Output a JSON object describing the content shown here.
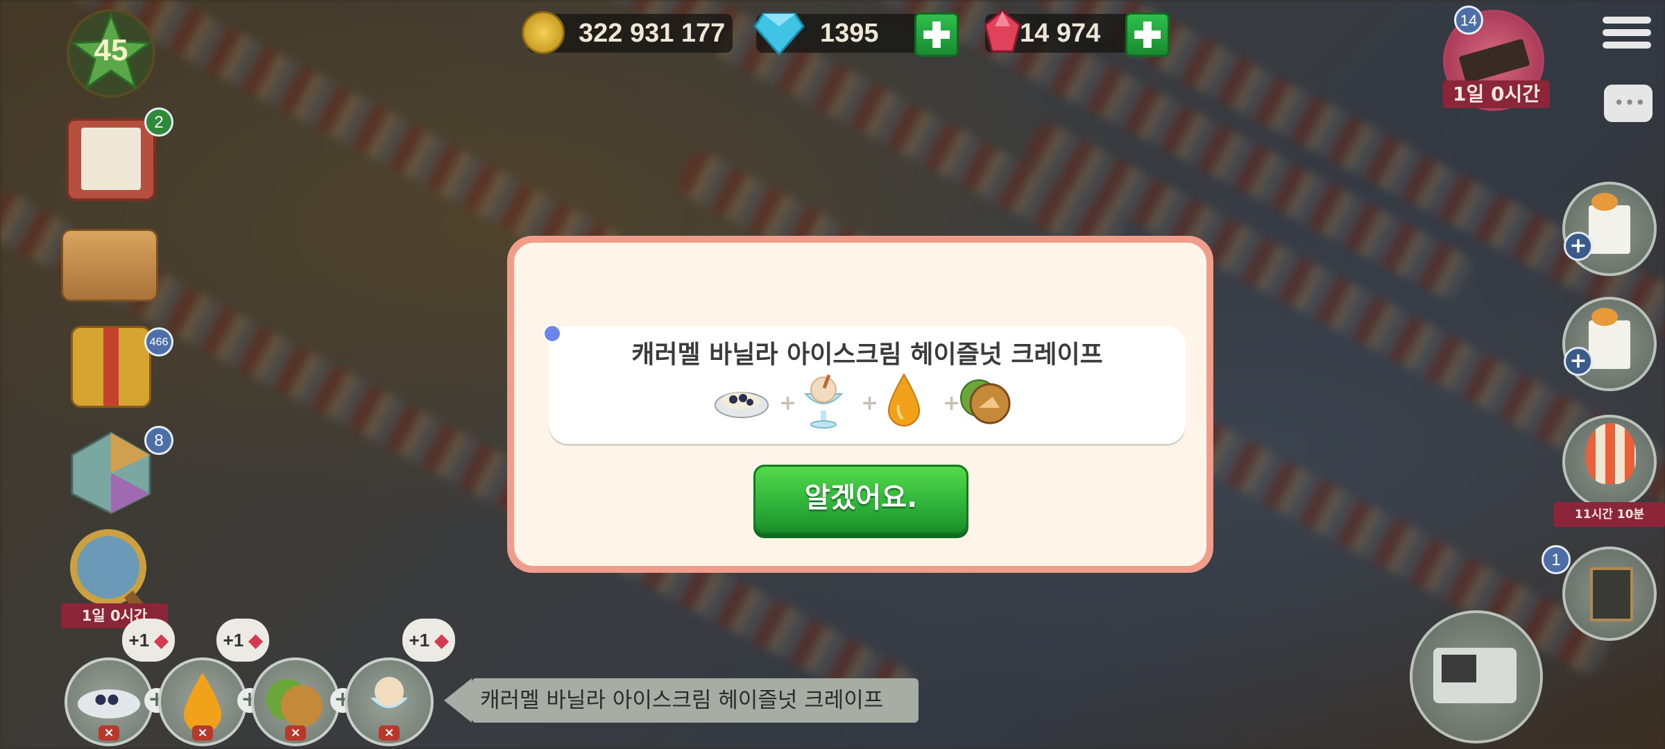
{
  "currency": {
    "coins": "322 931 177",
    "diamonds": "1395",
    "rubies": "14 974"
  },
  "player": {
    "level": "45"
  },
  "left_badges": {
    "tasks": "2",
    "gifts": "466",
    "gems": "8"
  },
  "left_timers": {
    "search": "1일 0시간"
  },
  "right_panel": {
    "event_count": "14",
    "event_timer": "1일 0시간",
    "balloon_timer": "11시간 10분",
    "board_count": "1"
  },
  "dialog": {
    "recipe_title": "캐러멜 바닐라 아이스크림 헤이즐넛 크레이프",
    "ingredients": [
      "crepe-icon",
      "ice-cream-icon",
      "caramel-drop-icon",
      "hazelnut-icon"
    ],
    "plus_sign": "+",
    "ok_label": "알겠어요."
  },
  "bottom_bar": {
    "recipe_name": "캐러멜 바닐라 아이스크림 헤이즐넛 크레이프",
    "bonus": [
      "+1",
      "+1",
      "",
      "+1"
    ],
    "remove": "×"
  }
}
